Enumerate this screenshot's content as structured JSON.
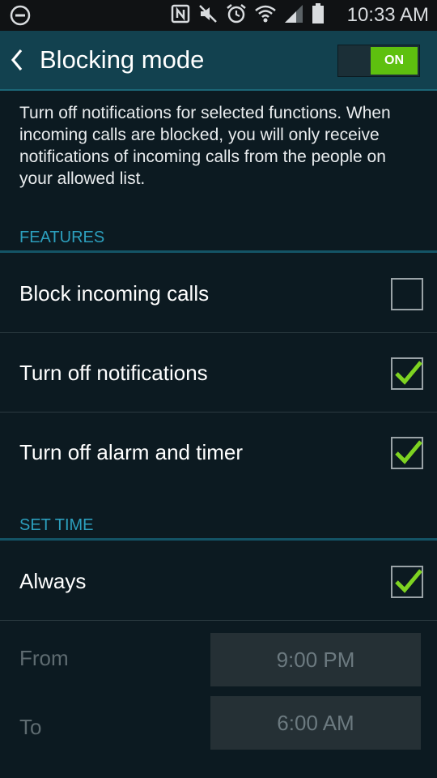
{
  "status_bar": {
    "time": "10:33 AM",
    "icons": [
      "do-not-disturb-icon",
      "nfc-icon",
      "mute-icon",
      "alarm-icon",
      "wifi-icon",
      "signal-icon",
      "battery-icon"
    ]
  },
  "header": {
    "title": "Blocking mode",
    "toggle_label": "ON",
    "toggle_on": true
  },
  "description": "Turn off notifications for selected functions. When incoming calls are blocked, you will only receive notifications of incoming calls from the people on your allowed list.",
  "features": {
    "header": "FEATURES",
    "items": [
      {
        "label": "Block incoming calls",
        "checked": false
      },
      {
        "label": "Turn off notifications",
        "checked": true
      },
      {
        "label": "Turn off alarm and timer",
        "checked": true
      }
    ]
  },
  "set_time": {
    "header": "SET TIME",
    "always": {
      "label": "Always",
      "checked": true
    },
    "from": {
      "label": "From",
      "value": "9:00 PM"
    },
    "to": {
      "label": "To",
      "value": "6:00 AM"
    }
  },
  "colors": {
    "accent": "#2c9fbd",
    "toggle_on": "#5ec00f",
    "check": "#7ed321",
    "background": "#0c1a21",
    "action_bar": "#12414f"
  }
}
